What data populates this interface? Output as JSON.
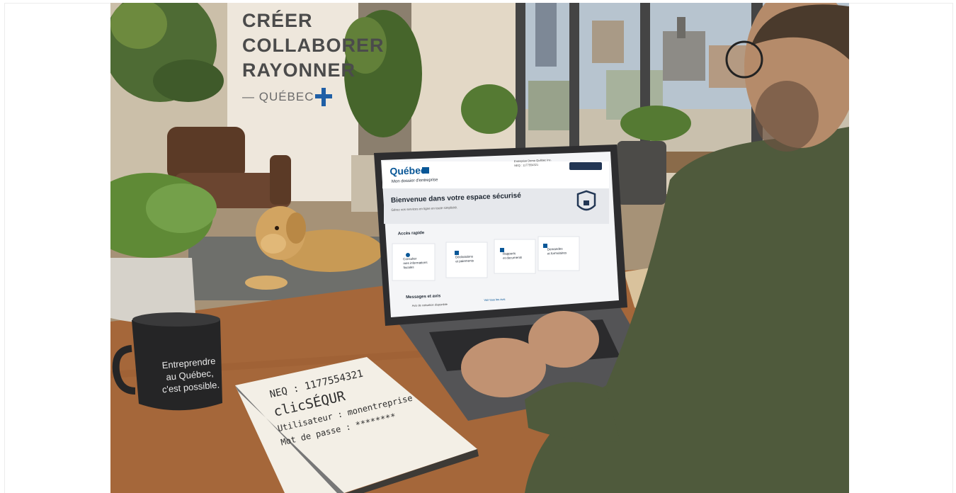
{
  "banner": {
    "line1": "CRÉER",
    "line2": "COLLABORER",
    "line3": "RAYONNER",
    "line4": "— QUÉBEC"
  },
  "screen": {
    "logo_text": "Québec",
    "subtitle": "Mon dossier d'entreprise",
    "header_info_1": "Entreprise Demo Québec Inc.",
    "header_info_2": "NEQ : 1177554321",
    "header_button": "Fermer la session",
    "welcome_title": "Bienvenue dans votre espace sécurisé",
    "welcome_sub": "Gérez vos services en ligne en toute simplicité.",
    "quick_access_title": "Accès rapide",
    "tiles": [
      {
        "line1": "Consulter",
        "line2": "mes informations",
        "line3": "fiscales"
      },
      {
        "line1": "Déclarations",
        "line2": "et paiements",
        "line3": ""
      },
      {
        "line1": "Rapports",
        "line2": "et documents",
        "line3": ""
      },
      {
        "line1": "Demandes",
        "line2": "et formulaires",
        "line3": ""
      }
    ],
    "messages_title": "Messages et avis",
    "messages_item": "Avis de cotisation disponible",
    "messages_link": "Voir tous les avis"
  },
  "mug": {
    "line1": "Entreprendre",
    "line2": "au Québec,",
    "line3": "c'est possible."
  },
  "notebook": {
    "line1": "NEQ : 1177554321",
    "line2": "clicSÉQUR",
    "line3": "Utilisateur : monentreprise",
    "line4": "Mot de passe : ********"
  },
  "colors": {
    "quebec_blue": "#095797",
    "wall": "#e9e2d6",
    "desk": "#a8683a",
    "shirt": "#4f5a3c"
  }
}
